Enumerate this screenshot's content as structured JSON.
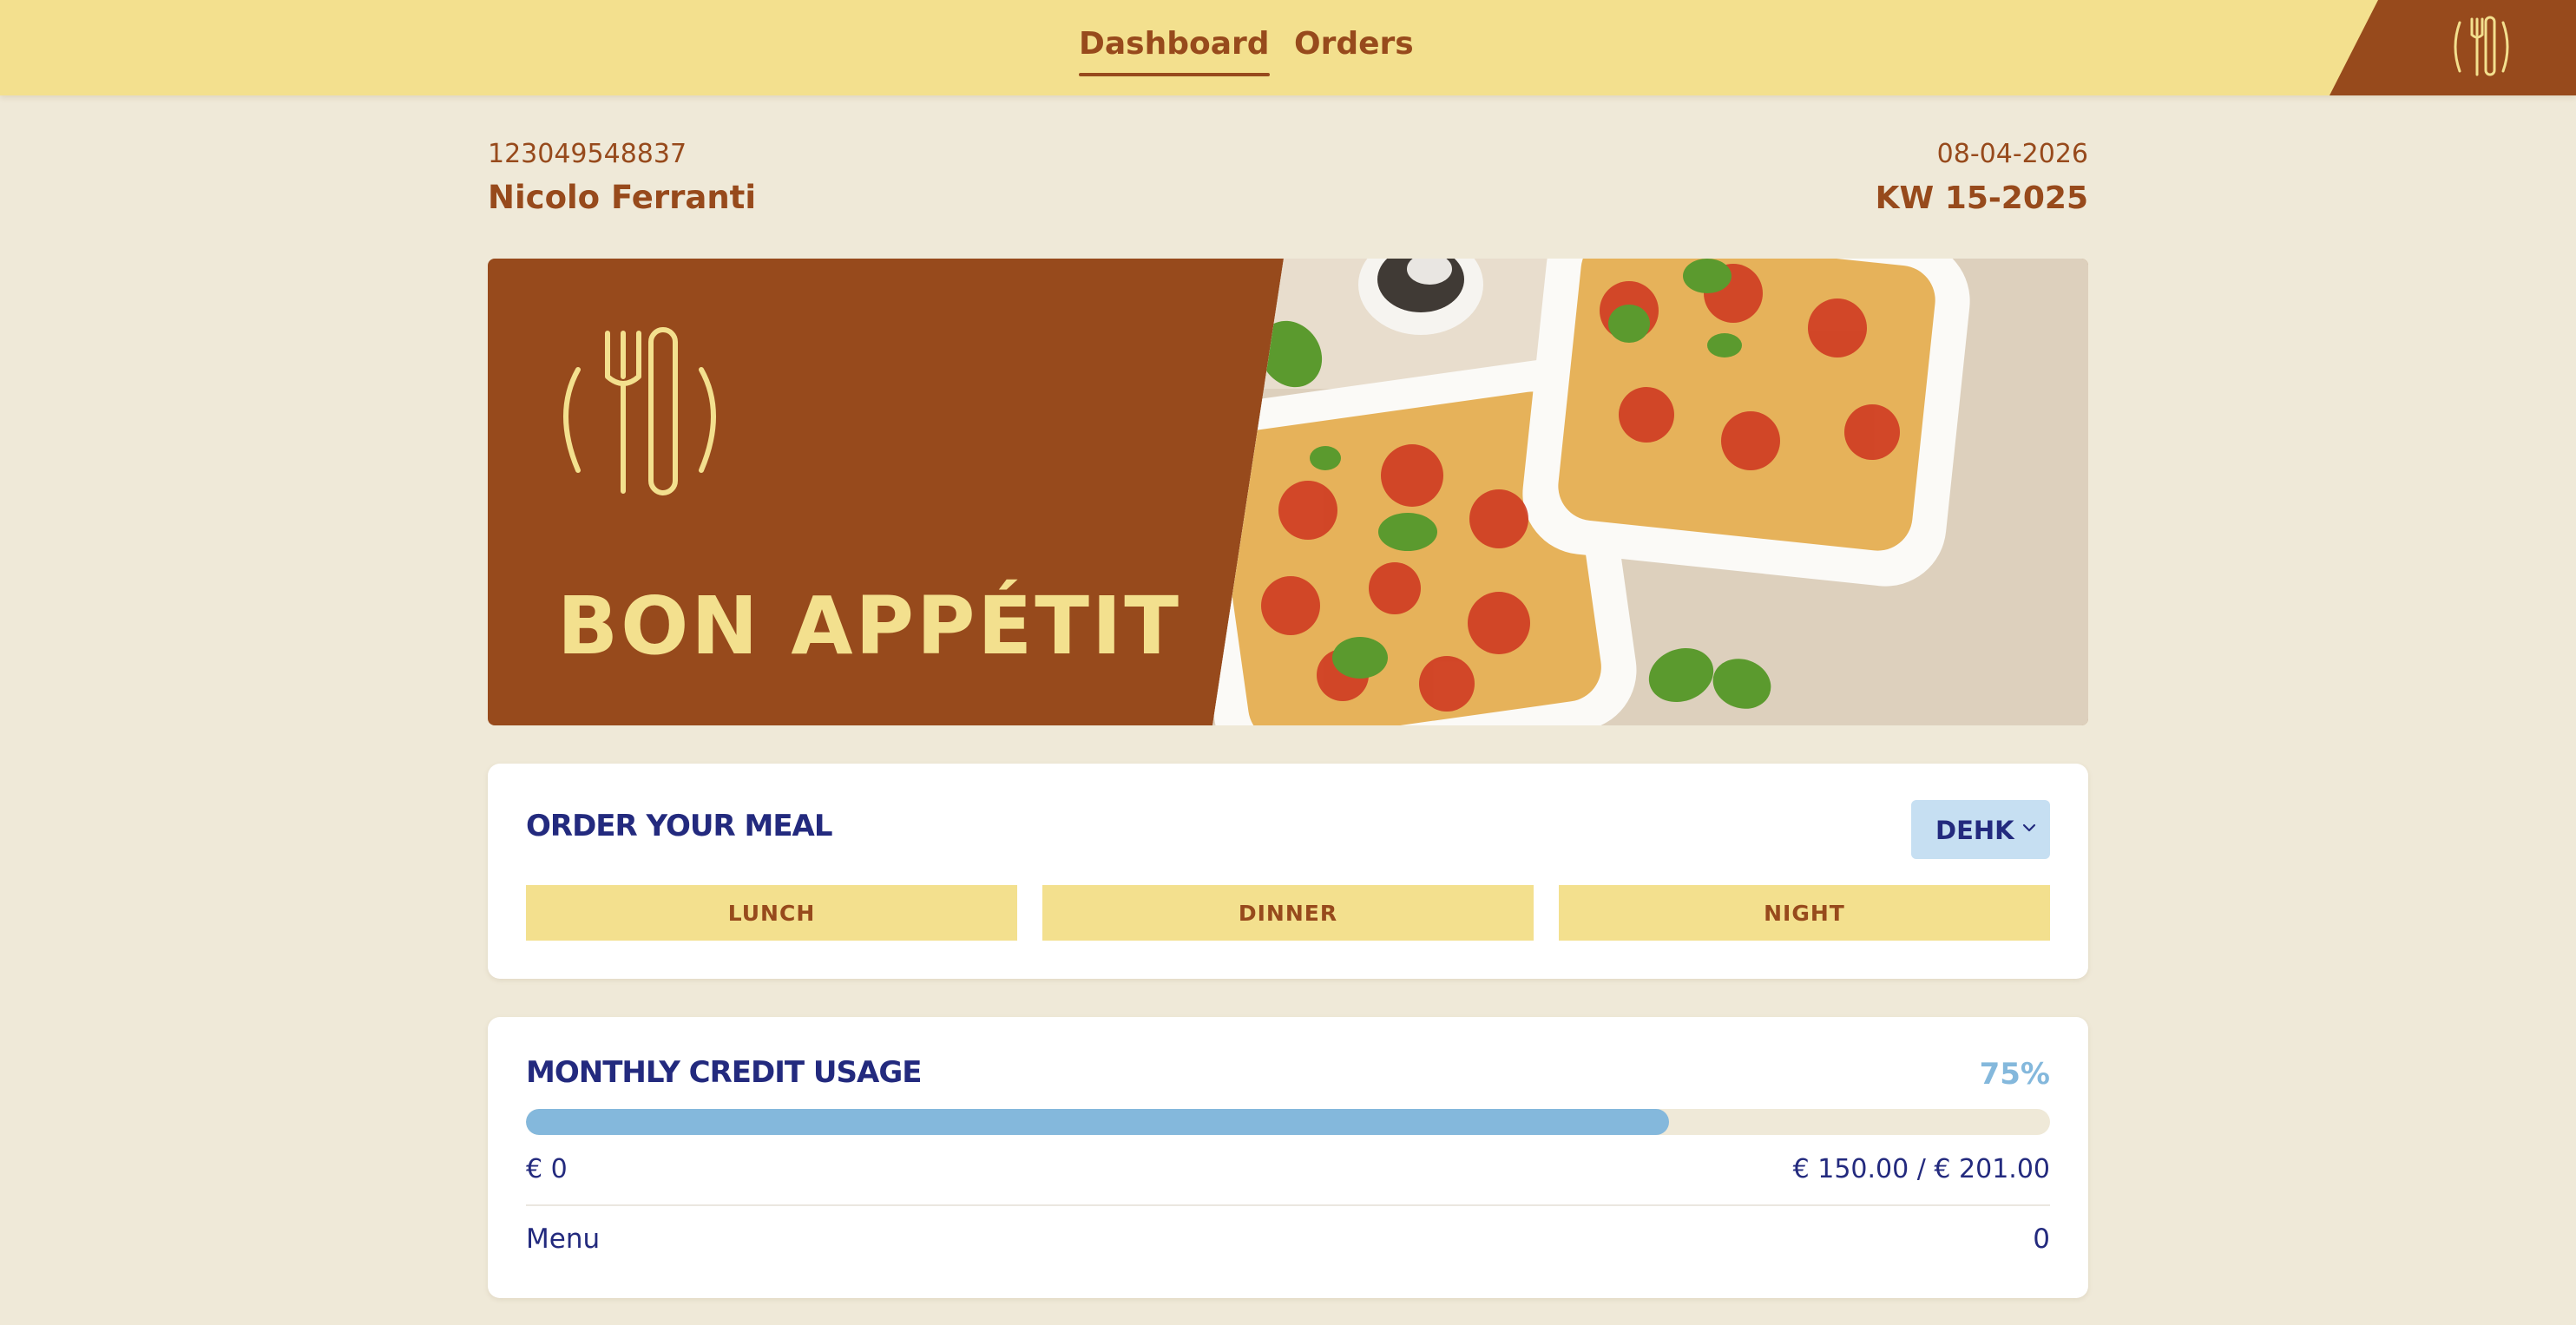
{
  "nav": {
    "tabs": [
      {
        "label": "Dashboard",
        "active": true
      },
      {
        "label": "Orders",
        "active": false
      }
    ],
    "corner_icon": "cutlery-icon"
  },
  "header": {
    "id": "123049548837",
    "name": "Nicolo Ferranti",
    "date": "08-04-2026",
    "week": "KW 15-2025"
  },
  "banner": {
    "title": "BON APPÉTIT",
    "logo_icon": "cutlery-icon",
    "photo": "lasagna-dishes-photo"
  },
  "order": {
    "title": "ORDER YOUR MEAL",
    "location_select": {
      "value": "DEHK",
      "icon": "chevron-down-icon"
    },
    "meals": [
      "LUNCH",
      "DINNER",
      "NIGHT"
    ]
  },
  "credit": {
    "title": "MONTHLY CREDIT USAGE",
    "percent_label": "75%",
    "progress_fraction": 0.75,
    "min_label": "€ 0",
    "usage_label": "€ 150.00 / € 201.00",
    "menu_label": "Menu",
    "menu_value": "0"
  },
  "colors": {
    "topbar": "#f3e08e",
    "brand_brown": "#974a1c",
    "navy": "#232a7e",
    "accent_blue": "#84b8dc",
    "background": "#efe9d8"
  }
}
